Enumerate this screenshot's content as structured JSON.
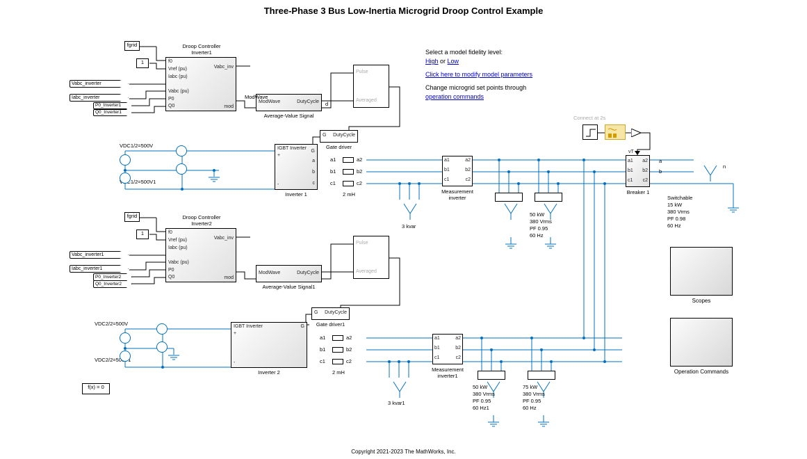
{
  "title": "Three-Phase 3 Bus Low-Inertia Microgrid Droop Control Example",
  "copyright": "Copyright 2021-2023 The MathWorks, Inc.",
  "info": {
    "select": "Select a model fidelity level:",
    "high": "High",
    "or": " or ",
    "low": "Low",
    "modify": "Click here to modify model parameters",
    "change": "Change microgrid set points through",
    "opcmd": "operation commands"
  },
  "blocks": {
    "fgrid": "fgrid",
    "one": "1",
    "droop1_title1": "Droop Controller",
    "droop1_title2": "Inverter1",
    "droop2_title1": "Droop Controller",
    "droop2_title2": "Inverter2",
    "avg1": "Average-Value Signal",
    "avg2": "Average-Value Signal1",
    "inverter1": "Inverter 1",
    "inverter2": "Inverter 2",
    "igbt": "IGBT Inverter",
    "twoMH": "2 mH",
    "threeKvar": "3 kvar",
    "threeKvar1": "3 kvar1",
    "gate": "Gate driver",
    "gate1": "Gate driver1",
    "meas_inv": "Measurement",
    "meas_inv2": "inverter",
    "meas_inv1a": "Measurement",
    "meas_inv1b": "inverter1",
    "load50": "50 kW",
    "load50b": "380 Vrms",
    "load50c": "PF 0.95",
    "load50d": "60 Hz",
    "load50d1": "60 Hz1",
    "load75": "75 kW",
    "breaker": "Breaker 1",
    "switchable_a": "Switchable",
    "switchable_b": "15 kW",
    "switchable_c": "380 Vrms",
    "switchable_d": "PF 0.98",
    "switchable_e": "60 Hz",
    "scopes": "Scopes",
    "opcommands": "Operation Commands",
    "connect2s": "Connect at 2s",
    "vdc1a": "VDC1/2=500V",
    "vdc1b": "VDC1/2=500V1",
    "vdc2a": "VDC2/2=500V",
    "vdc2b": "VDC2/2=500V1",
    "fx0": "f(x) = 0",
    "dutycycle": "DutyCycle",
    "modwave": "ModWave",
    "pulse": "Pulse",
    "averaged": "Averaged",
    "vabc_inv": "Vabc_inv",
    "mod": "mod",
    "g_port": "G",
    "d_port": "d",
    "vt": "vT",
    "plus": "+",
    "minus": "-"
  },
  "ports": {
    "f0": "f0",
    "vref": "Vref (pu)",
    "iabc": "Iabc (pu)",
    "vabc": "Vabc (pu)",
    "p0": "P0",
    "q0": "Q0",
    "a1": "a1",
    "a2": "a2",
    "b1": "b1",
    "b2": "b2",
    "c1": "c1",
    "c2": "c2",
    "a": "a",
    "b": "b",
    "c": "c",
    "n": "n"
  },
  "tags": {
    "vabc_inv": "Vabc_inverter",
    "iabc_inv": "Iabc_inverter",
    "vabc_inv1": "Vabc_inverter1",
    "iabc_inv1": "Iabc_inverter1",
    "p0_inv1": "P0_Inverter1",
    "q0_inv1": "Q0_Inverter1",
    "p0_inv2": "P0_Inverter2",
    "q0_inv2": "Q0_Inverter2"
  }
}
